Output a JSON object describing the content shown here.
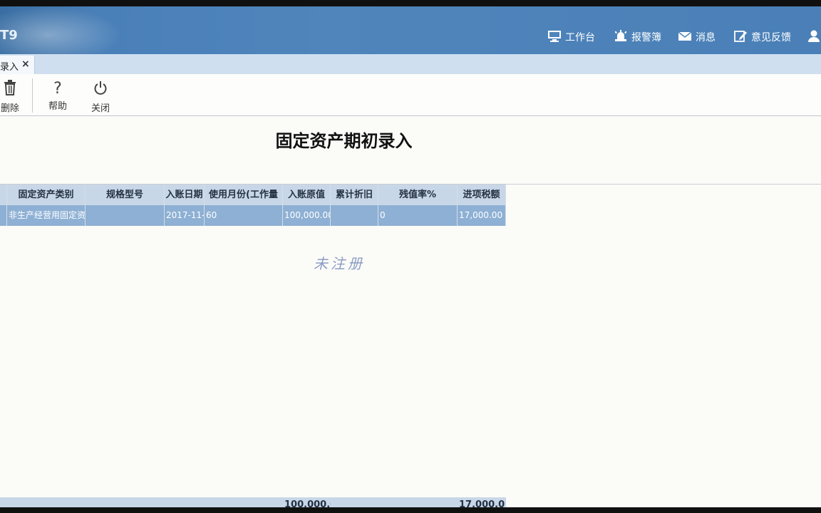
{
  "app": {
    "logo_text": "T9"
  },
  "nav": {
    "items": [
      {
        "label": "工作台",
        "icon": "monitor-icon"
      },
      {
        "label": "报警簿",
        "icon": "alarm-icon"
      },
      {
        "label": "消息",
        "icon": "mail-icon"
      },
      {
        "label": "意见反馈",
        "icon": "feedback-icon"
      }
    ],
    "user_icon": "user-icon"
  },
  "tab": {
    "label": "录入",
    "close": "×"
  },
  "toolbar": {
    "delete_label": "删除",
    "help_label": "帮助",
    "close_label": "关闭",
    "help_glyph": "?"
  },
  "page": {
    "title": "固定资产期初录入",
    "watermark": "未注册"
  },
  "table": {
    "columns": [
      "固定资产类别",
      "规格型号",
      "入账日期",
      "使用月份(工作量",
      "入账原值",
      "累计折旧",
      "残值率%",
      "进项税额"
    ],
    "rows": [
      [
        "非生产经营用固定资",
        "",
        "2017-11-",
        "60",
        "100,000.00",
        "",
        "0",
        "17,000.00"
      ]
    ],
    "totals": [
      "100,000.0",
      "17,000.0"
    ]
  },
  "colors": {
    "header_bg": "#4a80b8",
    "selected_row": "#8eb0d4",
    "grid_header": "#c8d7e8"
  }
}
